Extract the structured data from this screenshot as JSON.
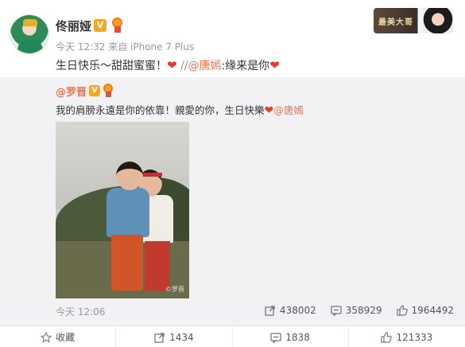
{
  "post": {
    "author": "佟丽娅",
    "vbadge": "V",
    "time": "今天 12:32",
    "source": " 来自 iPhone 7 Plus",
    "content_text": "生日快乐～甜甜蜜蜜！",
    "content_heart": "❤",
    "content_slash": " //",
    "content_mention": "@唐嫣",
    "content_tail": ":缘来是你",
    "content_heart2": "❤",
    "card_text": "最美大哥"
  },
  "repost": {
    "author": "@罗晋",
    "vbadge": "V",
    "text": "我的肩膀永遠是你的依靠！親愛的你，生日快樂",
    "heart": "❤",
    "mention": "@唐嫣",
    "photo_watermark": "©罗晋",
    "time": "今天 12:06",
    "stats": {
      "reposts": "438002",
      "comments": "358929",
      "likes": "1964492"
    }
  },
  "actions": {
    "favorite": "收藏",
    "repost": "1434",
    "comment": "1838",
    "like": "121333"
  },
  "colors": {
    "accent": "#eb7350",
    "heart": "#e83a2c",
    "vbadge": "#f5a623",
    "repost_bg": "#f2f2f5"
  }
}
